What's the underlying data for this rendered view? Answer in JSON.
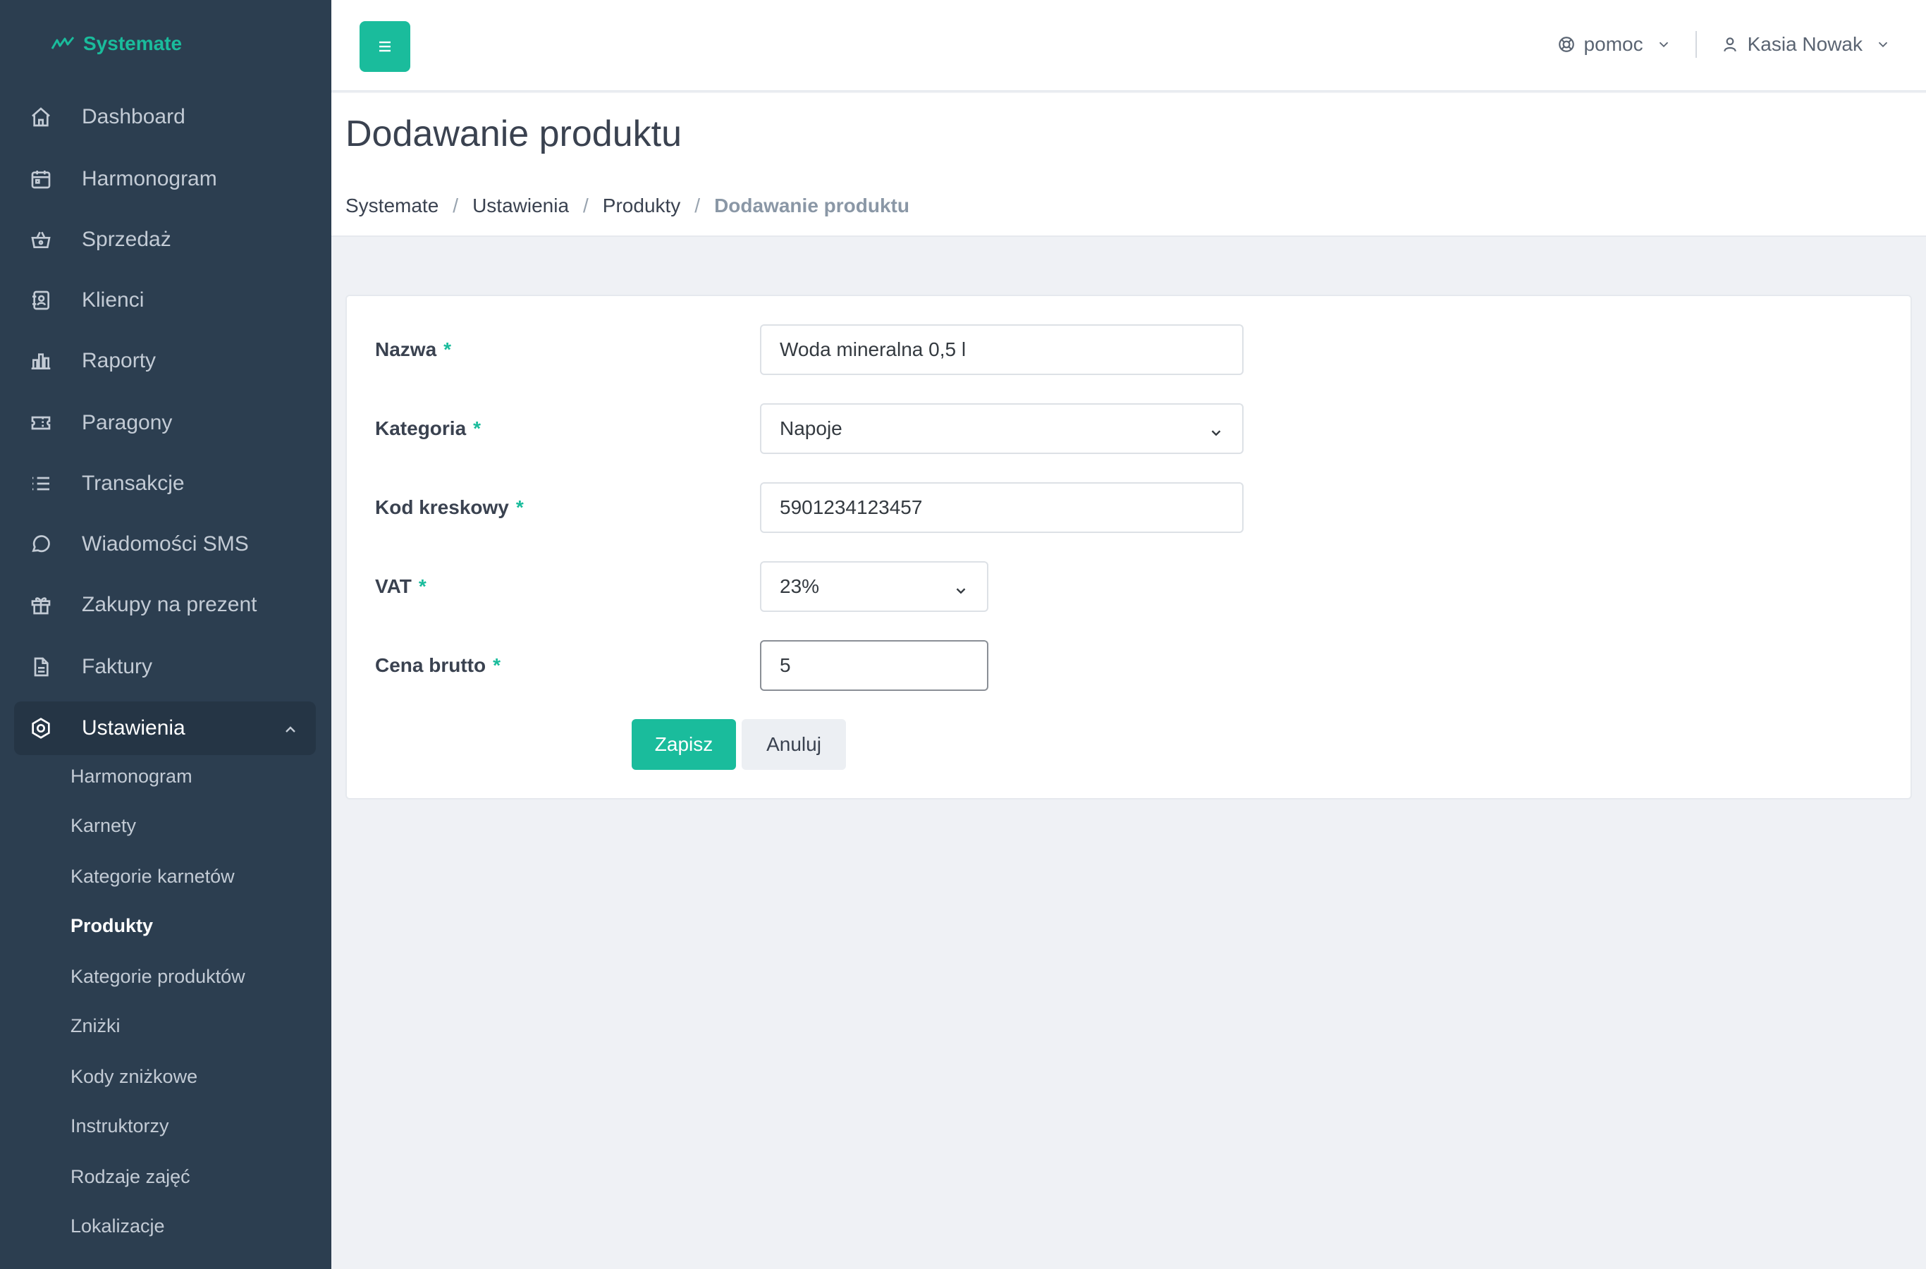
{
  "app": {
    "name": "Systemate"
  },
  "sidebar": {
    "items": [
      {
        "label": "Dashboard",
        "icon": "home-icon"
      },
      {
        "label": "Harmonogram",
        "icon": "calendar-icon"
      },
      {
        "label": "Sprzedaż",
        "icon": "basket-icon"
      },
      {
        "label": "Klienci",
        "icon": "address-book-icon"
      },
      {
        "label": "Raporty",
        "icon": "bar-chart-icon"
      },
      {
        "label": "Paragony",
        "icon": "ticket-icon"
      },
      {
        "label": "Transakcje",
        "icon": "list-icon"
      },
      {
        "label": "Wiadomości SMS",
        "icon": "message-icon"
      },
      {
        "label": "Zakupy na prezent",
        "icon": "gift-icon"
      },
      {
        "label": "Faktury",
        "icon": "document-icon"
      },
      {
        "label": "Ustawienia",
        "icon": "settings-icon",
        "active": true
      }
    ],
    "submenu": [
      {
        "label": "Harmonogram"
      },
      {
        "label": "Karnety"
      },
      {
        "label": "Kategorie karnetów"
      },
      {
        "label": "Produkty",
        "current": true
      },
      {
        "label": "Kategorie produktów"
      },
      {
        "label": "Zniżki"
      },
      {
        "label": "Kody zniżkowe"
      },
      {
        "label": "Instruktorzy"
      },
      {
        "label": "Rodzaje zajęć"
      },
      {
        "label": "Lokalizacje"
      }
    ]
  },
  "topbar": {
    "help_label": "pomoc",
    "user_name": "Kasia Nowak"
  },
  "page": {
    "title": "Dodawanie produktu",
    "breadcrumb": [
      "Systemate",
      "Ustawienia",
      "Produkty",
      "Dodawanie produktu"
    ]
  },
  "form": {
    "required_mark": "*",
    "name": {
      "label": "Nazwa",
      "value": "Woda mineralna 0,5 l"
    },
    "category": {
      "label": "Kategoria",
      "value": "Napoje"
    },
    "barcode": {
      "label": "Kod kreskowy",
      "value": "5901234123457"
    },
    "vat": {
      "label": "VAT",
      "value": "23%"
    },
    "price": {
      "label": "Cena brutto",
      "value": "5"
    },
    "save_label": "Zapisz",
    "cancel_label": "Anuluj"
  },
  "colors": {
    "accent": "#1abc9c",
    "sidebar_bg": "#2c3e50",
    "page_bg": "#eff1f5"
  }
}
